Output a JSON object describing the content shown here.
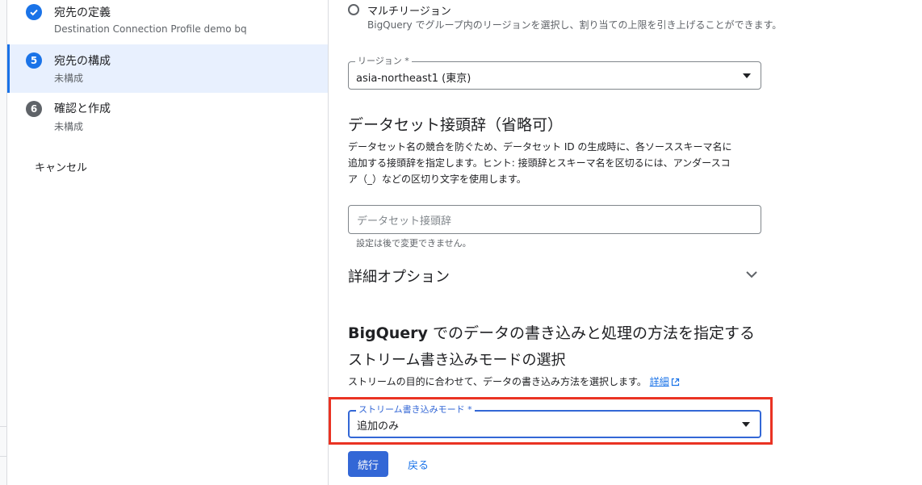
{
  "sidebar": {
    "steps": [
      {
        "number": "",
        "title": "宛先の定義",
        "subtitle": "Destination Connection Profile demo bq",
        "status": "complete"
      },
      {
        "number": "5",
        "title": "宛先の構成",
        "subtitle": "未構成",
        "status": "active"
      },
      {
        "number": "6",
        "title": "確認と作成",
        "subtitle": "未構成",
        "status": "pending"
      }
    ],
    "cancel_label": "キャンセル"
  },
  "region_type": {
    "multi_region_label": "マルチリージョン",
    "multi_region_desc": "BigQuery でグループ内のリージョンを選択し、割り当ての上限を引き上げることができます。"
  },
  "region_field": {
    "label": "リージョン *",
    "value": "asia-northeast1 (東京)"
  },
  "dataset_prefix": {
    "heading": "データセット接頭辞（省略可）",
    "desc_line1": "データセット名の競合を防ぐため、データセット ID の生成時に、各ソーススキーマ名に",
    "desc_line2": "追加する接頭辞を指定します。ヒント: 接頭辞とスキーマ名を区切るには、アンダースコ",
    "desc_line3": "ア（_）などの区切り文字を使用します。",
    "placeholder": "データセット接頭辞",
    "hint": "設定は後で変更できません。"
  },
  "advanced": {
    "label": "詳細オプション"
  },
  "write_section": {
    "heading_brand": "BigQuery",
    "heading_rest": " でのデータの書き込みと処理の方法を指定する",
    "subheading": "ストリーム書き込みモードの選択",
    "desc": "ストリームの目的に合わせて、データの書き込み方法を選択します。",
    "link": "詳細"
  },
  "write_mode": {
    "label": "ストリーム書き込みモード *",
    "value": "追加のみ"
  },
  "actions": {
    "continue_label": "続行",
    "back_label": "戻る"
  },
  "colors": {
    "accent": "#1a73e8",
    "primary_button": "#3367d6",
    "highlight_box": "#ea3323",
    "step_complete": "#1a73e8",
    "step_pending": "#5f6368"
  }
}
